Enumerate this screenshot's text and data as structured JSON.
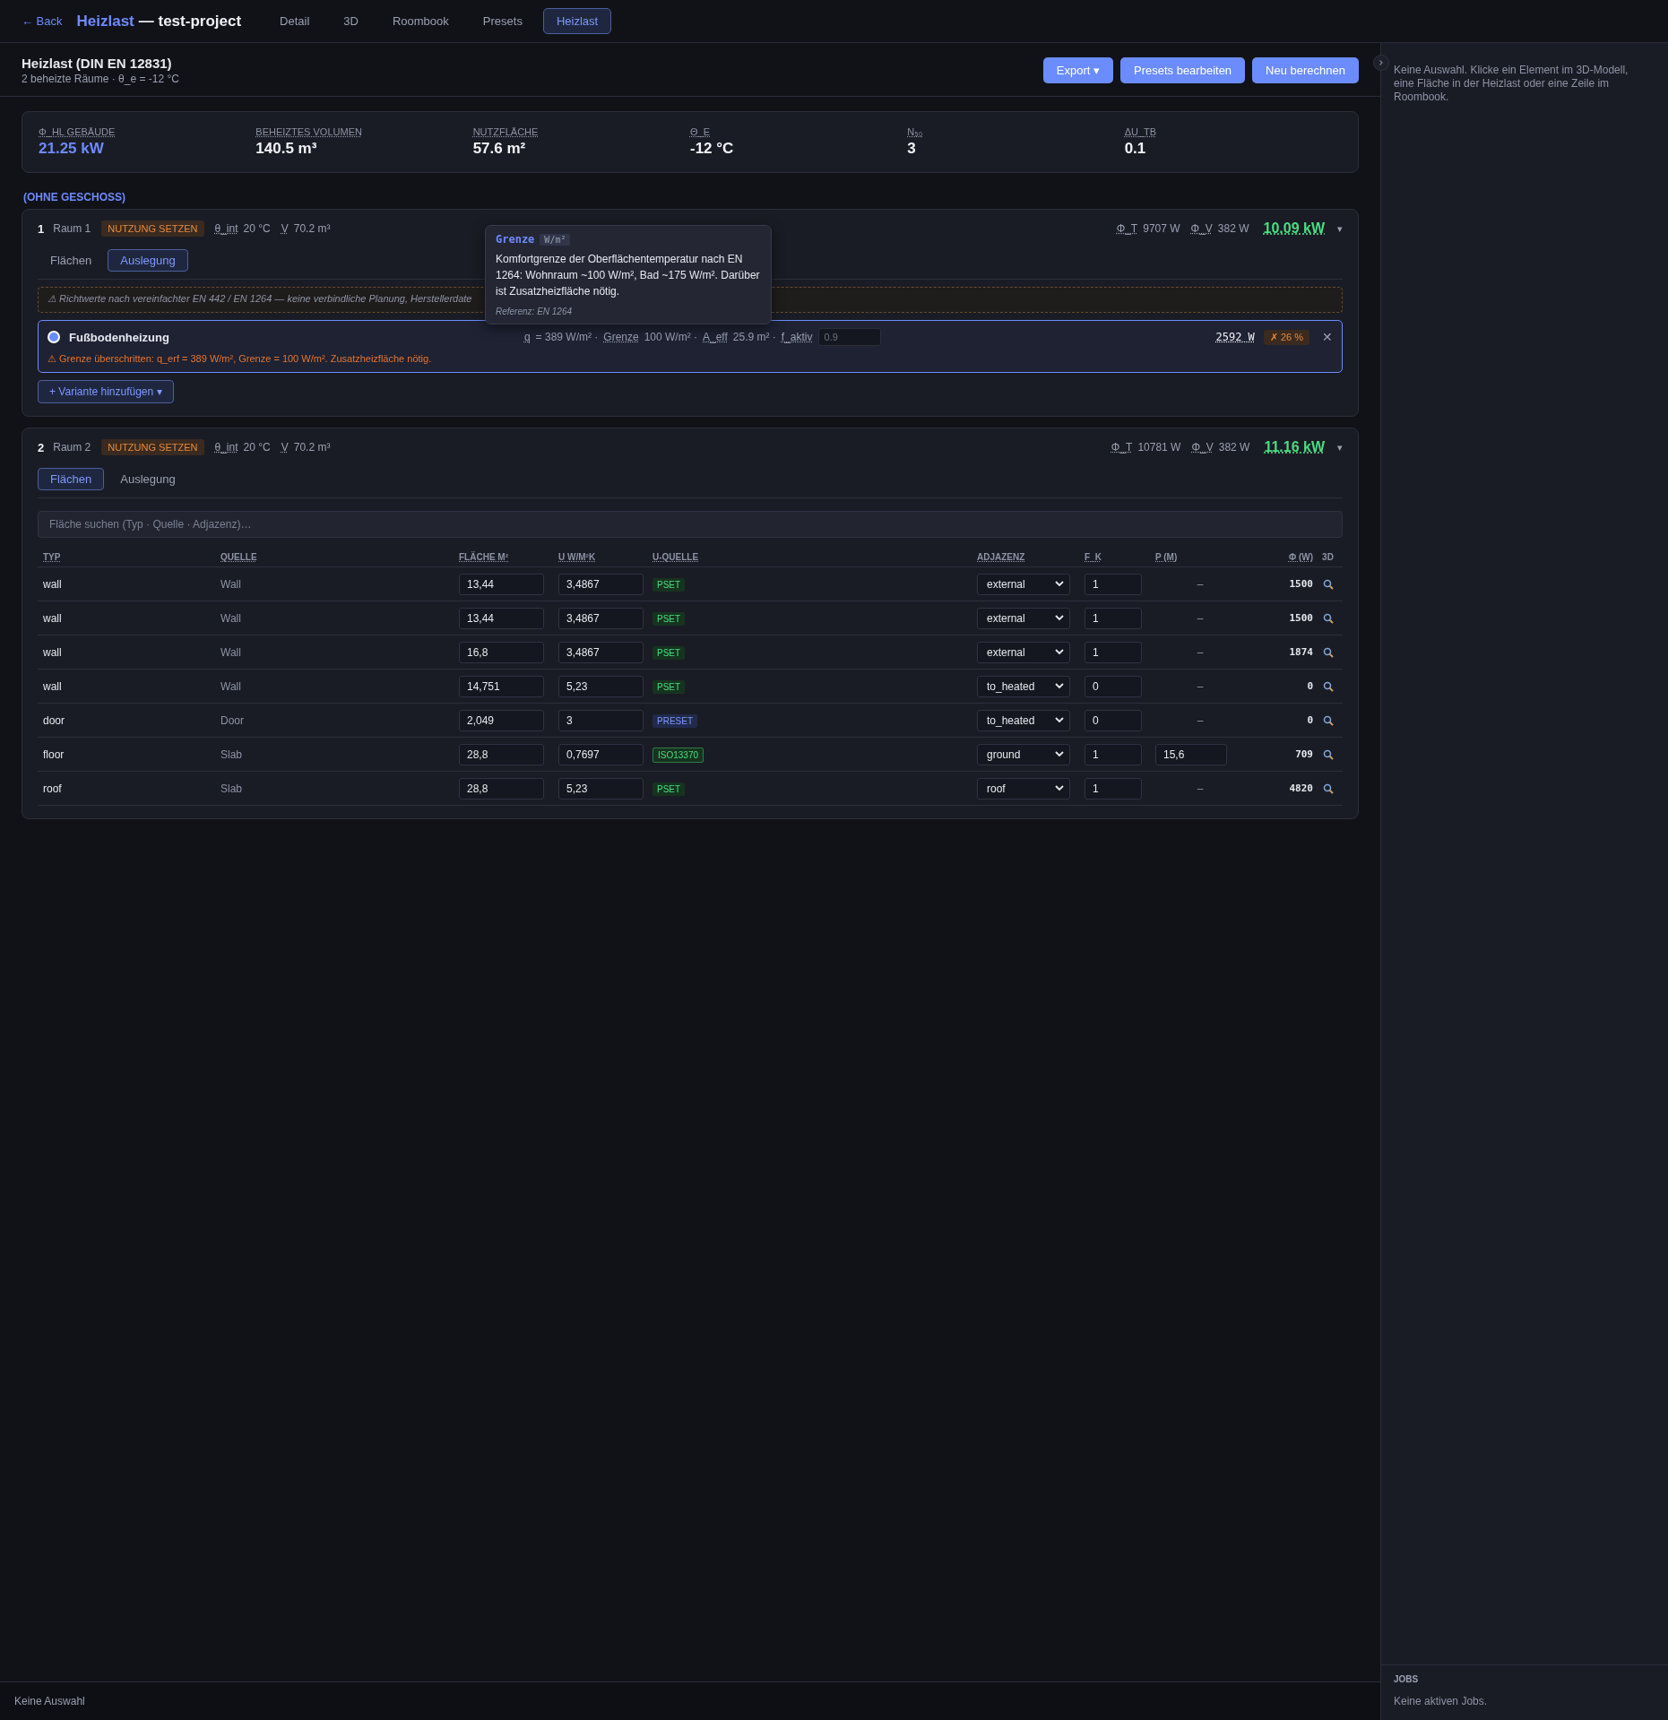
{
  "topbar": {
    "back": "← Back",
    "app": "Heizlast",
    "project": "— test-project",
    "tabs": [
      {
        "label": "Detail",
        "selected": false
      },
      {
        "label": "3D",
        "selected": false
      },
      {
        "label": "Roombook",
        "selected": false
      },
      {
        "label": "Presets",
        "selected": false
      },
      {
        "label": "Heizlast",
        "selected": true
      }
    ]
  },
  "header": {
    "title": "Heizlast (DIN EN 12831)",
    "subtitle": "2 beheizte Räume · θ_e = -12 °C",
    "buttons": [
      "Export ▾",
      "Presets bearbeiten",
      "Neu berechnen"
    ]
  },
  "stats": [
    {
      "label": "Φ_HL GEBÄUDE",
      "value": "21.25 kW",
      "accent": true
    },
    {
      "label": "BEHEIZTES VOLUMEN",
      "value": "140.5 m³",
      "accent": false
    },
    {
      "label": "NUTZFLÄCHE",
      "value": "57.6 m²",
      "accent": false
    },
    {
      "label": "Θ_E",
      "value": "-12 °C",
      "accent": false
    },
    {
      "label": "N₅₀",
      "value": "3",
      "accent": false
    },
    {
      "label": "ΔU_TB",
      "value": "0.1",
      "accent": false
    }
  ],
  "floor_label": "(OHNE GESCHOSS)",
  "rooms": [
    {
      "number": "1",
      "name": "Raum 1",
      "badge": "NUTZUNG SETZEN",
      "theta_label": "θ_int",
      "theta": "20 °C",
      "volume_label": "V",
      "volume": "70.2 m³",
      "phi_t_label": "Φ_T",
      "phi_t": "9707 W",
      "phi_v_label": "Φ_V",
      "phi_v": "382 W",
      "total": "10.09 kW",
      "caret": "▾",
      "tabs": [
        {
          "label": "Flächen",
          "selected": false
        },
        {
          "label": "Auslegung",
          "selected": true
        }
      ],
      "design": {
        "notice": "⚠ Richtwerte nach vereinfachter EN 442 / EN 1264 — keine verbindliche Planung, Herstellerdate",
        "variants": [
          {
            "name": "Fußbodenheizung",
            "selected": true,
            "params": [
              {
                "label": "q",
                "value": "= 389 W/m² ·"
              },
              {
                "label": "Grenze",
                "value": "100 W/m² ·"
              },
              {
                "label": "A_eff",
                "value": "25.9 m² ·"
              },
              {
                "label": "f_aktiv"
              }
            ],
            "factor_placeholder": "0.9",
            "power": "2592 W",
            "deviation": "✗ 26 %",
            "close": "✕",
            "error": "⚠ Grenze überschritten: q_erf = 389 W/m², Grenze = 100 W/m². Zusatzheizfläche nötig."
          }
        ],
        "add_button": "+ Variante hinzufügen ▾",
        "tooltip": {
          "title": "Grenze",
          "unit": "W/m²",
          "text": "Komfortgrenze der Oberflächentemperatur nach EN 1264: Wohnraum ~100 W/m², Bad ~175 W/m². Darüber ist Zusatzheizfläche nötig.",
          "reference": "Referenz: EN 1264"
        }
      }
    },
    {
      "number": "2",
      "name": "Raum 2",
      "badge": "NUTZUNG SETZEN",
      "theta_label": "θ_int",
      "theta": "20 °C",
      "volume_label": "V",
      "volume": "70.2 m³",
      "phi_t_label": "Φ_T",
      "phi_t": "10781 W",
      "phi_v_label": "Φ_V",
      "phi_v": "382 W",
      "total": "11.16 kW",
      "caret": "▾",
      "tabs": [
        {
          "label": "Flächen",
          "selected": true
        },
        {
          "label": "Auslegung",
          "selected": false
        }
      ],
      "surfaces": {
        "search_placeholder": "Fläche suchen (Typ · Quelle · Adjazenz)…",
        "columns": [
          "TYP",
          "QUELLE",
          "FLÄCHE M²",
          "U W/M²K",
          "U-QUELLE",
          "ADJAZENZ",
          "F_K",
          "P (M)",
          "Φ (W)",
          "3D"
        ],
        "rows": [
          {
            "type": "wall",
            "source": "Wall",
            "area": "13,44",
            "u": "3,4867",
            "u_source": {
              "label": "PSET",
              "kind": "pset"
            },
            "adjacency": "external",
            "fk": "1",
            "p": {
              "kind": "text",
              "value": "–"
            },
            "phi": "1500"
          },
          {
            "type": "wall",
            "source": "Wall",
            "area": "13,44",
            "u": "3,4867",
            "u_source": {
              "label": "PSET",
              "kind": "pset"
            },
            "adjacency": "external",
            "fk": "1",
            "p": {
              "kind": "text",
              "value": "–"
            },
            "phi": "1500"
          },
          {
            "type": "wall",
            "source": "Wall",
            "area": "16,8",
            "u": "3,4867",
            "u_source": {
              "label": "PSET",
              "kind": "pset"
            },
            "adjacency": "external",
            "fk": "1",
            "p": {
              "kind": "text",
              "value": "–"
            },
            "phi": "1874"
          },
          {
            "type": "wall",
            "source": "Wall",
            "area": "14,751",
            "u": "5,23",
            "u_source": {
              "label": "PSET",
              "kind": "pset"
            },
            "adjacency": "to_heated",
            "fk": "0",
            "p": {
              "kind": "text",
              "value": "–"
            },
            "phi": "0"
          },
          {
            "type": "door",
            "source": "Door",
            "area": "2,049",
            "u": "3",
            "u_source": {
              "label": "PRESET",
              "kind": "preset"
            },
            "adjacency": "to_heated",
            "fk": "0",
            "p": {
              "kind": "text",
              "value": "–"
            },
            "phi": "0"
          },
          {
            "type": "floor",
            "source": "Slab",
            "area": "28,8",
            "u": "0,7697",
            "u_source": {
              "label": "ISO13370",
              "kind": "iso"
            },
            "adjacency": "ground",
            "fk": "1",
            "p": {
              "kind": "input",
              "value": "15,6"
            },
            "phi": "709"
          },
          {
            "type": "roof",
            "source": "Slab",
            "area": "28,8",
            "u": "5,23",
            "u_source": {
              "label": "PSET",
              "kind": "pset"
            },
            "adjacency": "roof",
            "fk": "1",
            "p": {
              "kind": "text",
              "value": "–"
            },
            "phi": "4820"
          }
        ]
      }
    }
  ],
  "status_bar": "Keine Auswahl",
  "side_panel": {
    "hint": "Keine Auswahl. Klicke ein Element im 3D-Modell, eine Fläche in der Heizlast oder eine Zeile im Roombook.",
    "jobs_title": "JOBS",
    "jobs_text": "Keine aktiven Jobs."
  }
}
